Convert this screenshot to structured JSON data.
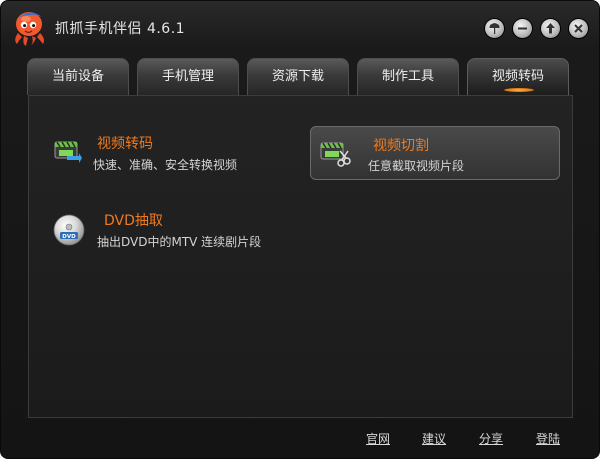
{
  "window": {
    "title": "抓抓手机伴侣 4.6.1",
    "controls": [
      "skin-icon",
      "minimize-icon",
      "upgrade-icon",
      "close-icon"
    ]
  },
  "tabs": [
    {
      "label": "当前设备",
      "active": false
    },
    {
      "label": "手机管理",
      "active": false
    },
    {
      "label": "资源下载",
      "active": false
    },
    {
      "label": "制作工具",
      "active": false
    },
    {
      "label": "视频转码",
      "active": true
    }
  ],
  "features": [
    {
      "title": "视频转码",
      "desc": "快速、准确、安全转换视频",
      "icon": "video-convert-icon",
      "highlighted": false
    },
    {
      "title": "视频切割",
      "desc": "任意截取视频片段",
      "icon": "video-cut-icon",
      "highlighted": true
    },
    {
      "title": "DVD抽取",
      "desc": "抽出DVD中的MTV 连续剧片段",
      "icon": "dvd-disc-icon",
      "highlighted": false
    }
  ],
  "dvd_icon_text": "DVD",
  "footer": {
    "official_site": "官网",
    "suggest": "建议",
    "share": "分享",
    "login": "登陆"
  },
  "colors": {
    "accent_orange": "#f07a1e",
    "window_bg": "#1a1a1a",
    "text_light": "#d4d4d4"
  }
}
